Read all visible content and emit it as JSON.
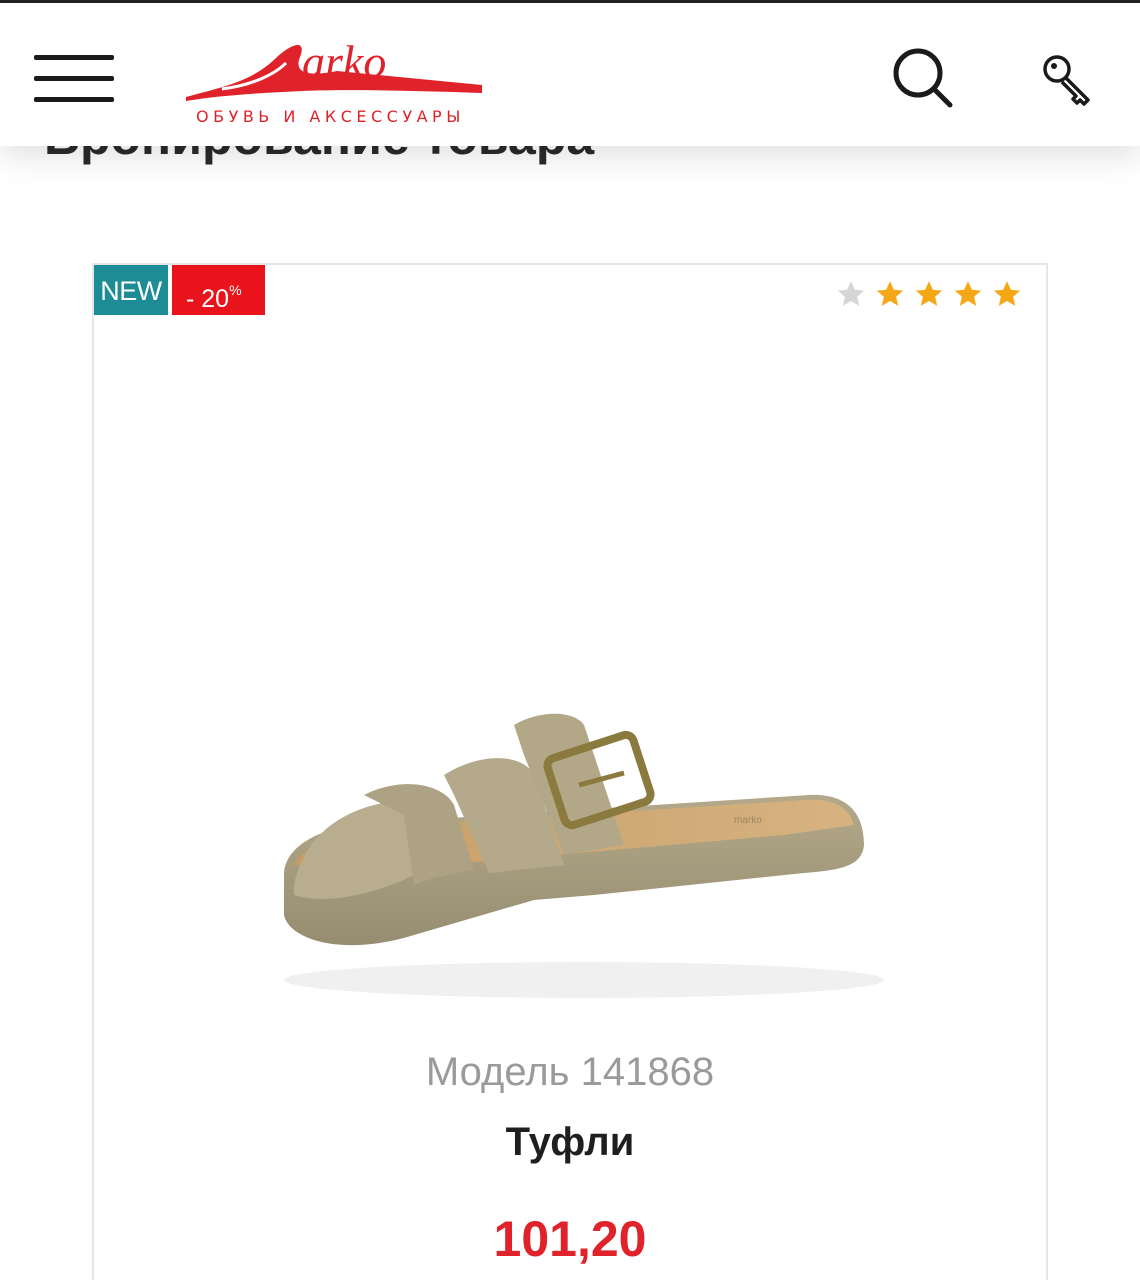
{
  "header": {
    "logo_name": "Marko",
    "logo_tagline": "ОБУВЬ И АКСЕССУАРЫ",
    "menu_icon": "hamburger-menu-icon",
    "search_icon": "search-icon",
    "login_icon": "key-icon"
  },
  "page": {
    "title": "Бронирование товара"
  },
  "product": {
    "badge_new": "NEW",
    "badge_discount": "- 20",
    "badge_discount_unit": "%",
    "rating": 4,
    "rating_max": 5,
    "model": "Модель 141868",
    "name": "Туфли",
    "price": "101,20"
  },
  "colors": {
    "brand_red": "#e0232a",
    "badge_new": "#1e8c95",
    "badge_sale": "#e8131b",
    "star_active": "#f4a818",
    "star_inactive": "#d6d6d6"
  }
}
